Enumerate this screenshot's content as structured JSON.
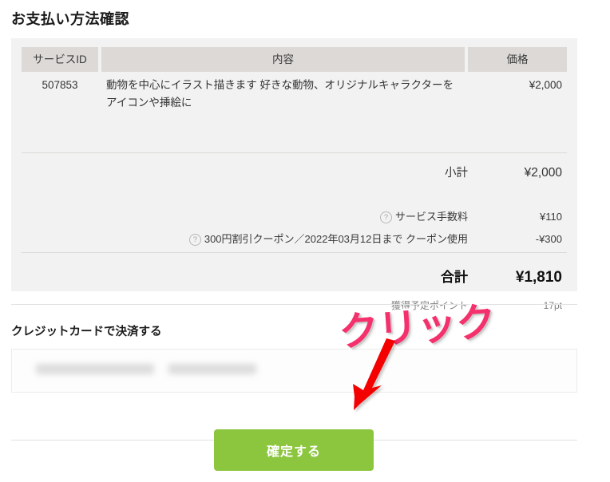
{
  "page": {
    "title": "お支払い方法確認"
  },
  "summary": {
    "columns": {
      "service_id": "サービスID",
      "content": "内容",
      "price": "価格"
    },
    "item": {
      "service_id": "507853",
      "description": "動物を中心にイラスト描きます 好きな動物、オリジナルキャラクターをアイコンや挿絵に",
      "price": "¥2,000"
    },
    "subtotal": {
      "label": "小計",
      "value": "¥2,000"
    },
    "service_fee": {
      "icon": "help-circle-icon",
      "label": "サービス手数料",
      "value": "¥110"
    },
    "coupon": {
      "icon": "help-circle-icon",
      "label": "300円割引クーポン／2022年03月12日まで クーポン使用",
      "value": "-¥300"
    },
    "total": {
      "label": "合計",
      "value": "¥1,810"
    },
    "points": {
      "label": "獲得予定ポイント",
      "value": "17pt"
    }
  },
  "payment": {
    "section_title": "クレジットカードで決済する",
    "card_masked_1": "",
    "card_masked_2": ""
  },
  "actions": {
    "confirm_label": "確定する"
  },
  "annotation": {
    "click_text": "クリック",
    "arrow": "down-left-arrow"
  },
  "colors": {
    "card_background": "#f2f2f2",
    "table_header": "#dcd9d7",
    "confirm_button": "#8cc63e",
    "annotation_pink": "#f5316d",
    "annotation_arrow_red": "#f40000",
    "divider": "#e2e2e2"
  }
}
